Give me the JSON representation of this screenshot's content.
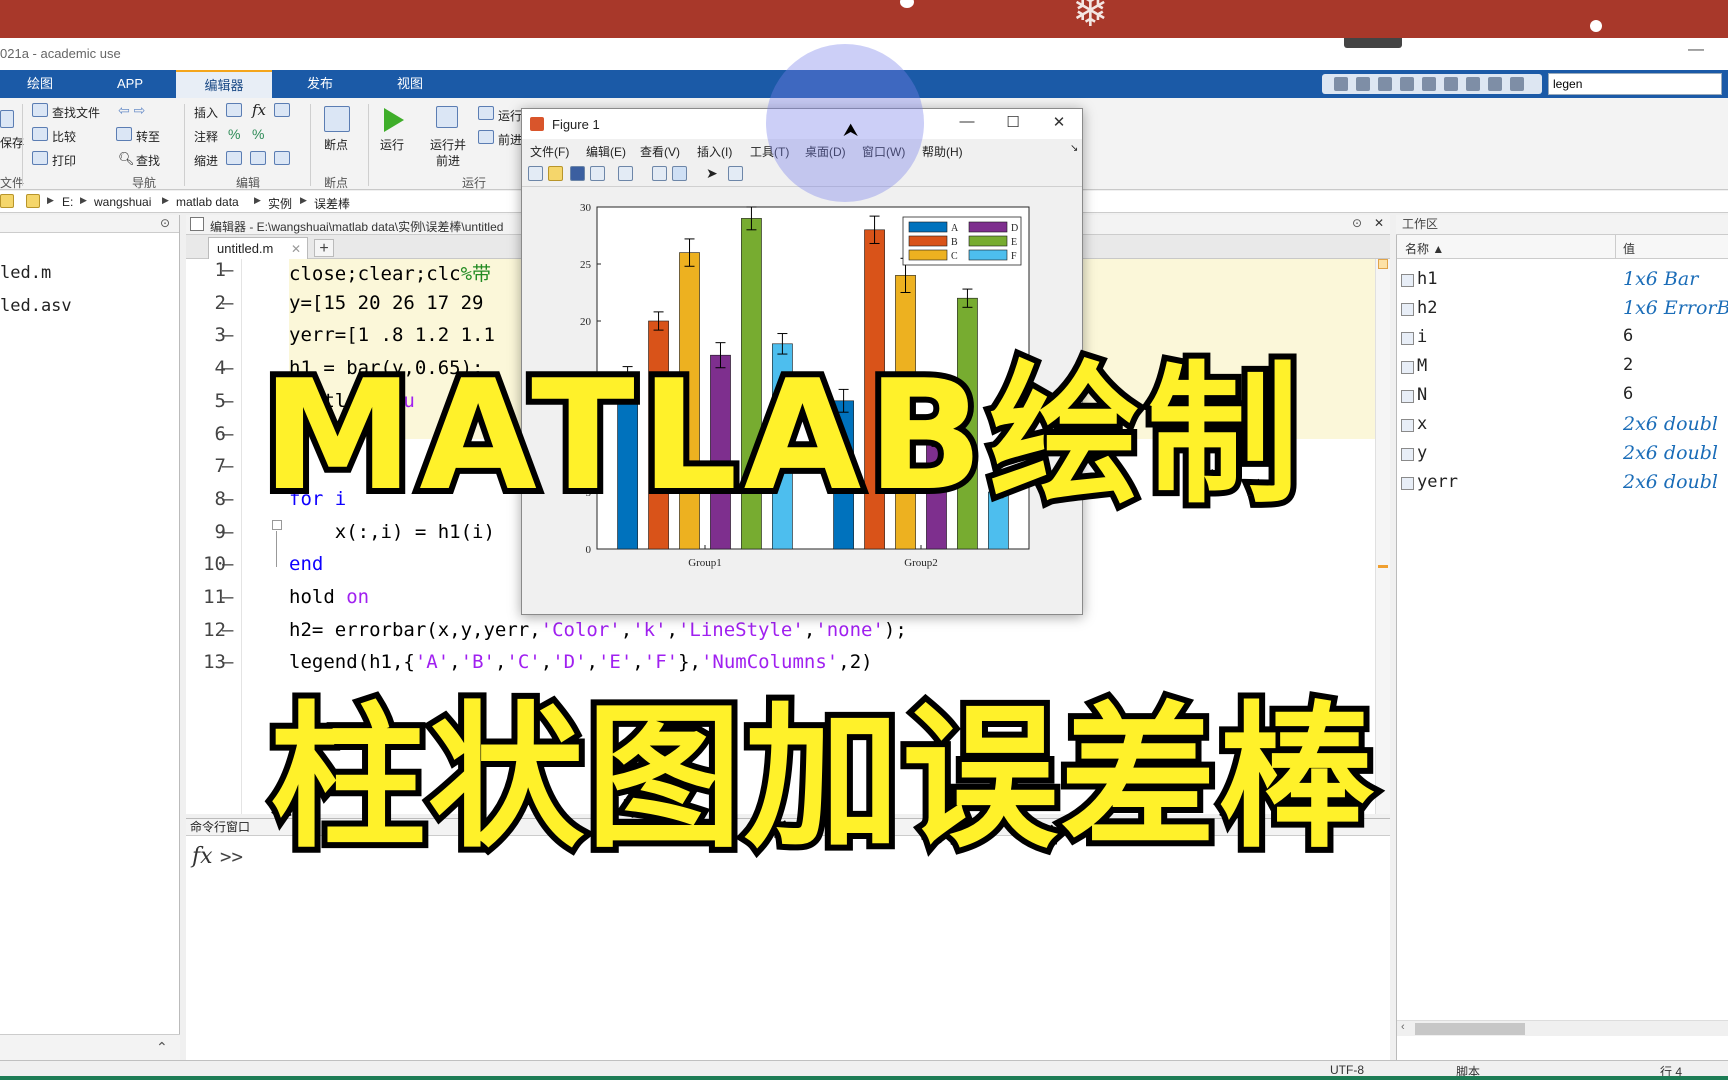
{
  "app": {
    "title": "021a - academic use",
    "minimize": "—"
  },
  "ribbon": {
    "tabs": [
      "绘图",
      "APP",
      "编辑器",
      "发布",
      "视图"
    ],
    "active_tab": "编辑器",
    "search_value": "legen",
    "file_group": {
      "save_label": "保存",
      "section": "文件"
    },
    "nav_group": {
      "find_files": "查找文件",
      "compare": "比较",
      "print": "打印",
      "goto": "转至",
      "find": "查找",
      "section": "导航"
    },
    "edit_group": {
      "insert": "插入",
      "comment": "注释",
      "indent": "缩进",
      "fx": "fx",
      "pct1": "%",
      "pct2": "%",
      "section": "编辑"
    },
    "breakpoint_group": {
      "label": "断点",
      "section": "断点"
    },
    "run_group": {
      "run": "运行",
      "run_advance_1": "运行并",
      "run_advance_2": "前进",
      "run_section": "运行节",
      "advance": "前进",
      "section": "运行"
    }
  },
  "address": {
    "crumbs": [
      "E:",
      "wangshuai",
      "matlab data",
      "实例",
      "误差棒"
    ]
  },
  "file_panel": {
    "files": [
      "led.m",
      "led.asv"
    ]
  },
  "editor": {
    "header": "编辑器 - E:\\wangshuai\\matlab data\\实例\\误差棒\\untitled",
    "tab": "untitled.m",
    "tab_close": "✕",
    "tab_add": "+",
    "lines": [
      {
        "n": "1",
        "code": [
          {
            "t": "close;clear;clc",
            "c": ""
          },
          {
            "t": "%带",
            "c": "cmt"
          }
        ]
      },
      {
        "n": "2",
        "code": [
          {
            "t": "y=[15 20 26 17 29",
            "c": ""
          }
        ]
      },
      {
        "n": "3",
        "code": [
          {
            "t": "yerr=[1 .8 1.2 1.1",
            "c": ""
          }
        ]
      },
      {
        "n": "4",
        "code": [
          {
            "t": "h1 = bar(y,0.65);",
            "c": ""
          }
        ]
      },
      {
        "n": "5",
        "code": [
          {
            "t": "   tls({",
            "c": ""
          },
          {
            "t": "'Gu",
            "c": "str"
          }
        ]
      },
      {
        "n": "6",
        "code": []
      },
      {
        "n": "7",
        "code": []
      },
      {
        "n": "8",
        "code": [
          {
            "t": "for i",
            "c": "kw"
          }
        ]
      },
      {
        "n": "9",
        "code": [
          {
            "t": "    x(:,i) = h1(i)",
            "c": ""
          }
        ]
      },
      {
        "n": "10",
        "code": [
          {
            "t": "end",
            "c": "kw"
          }
        ]
      },
      {
        "n": "11",
        "code": [
          {
            "t": "hold ",
            "c": ""
          },
          {
            "t": "on",
            "c": "str"
          }
        ]
      },
      {
        "n": "12",
        "code": [
          {
            "t": "h2= errorbar(x,y,yerr,",
            "c": ""
          },
          {
            "t": "'Color'",
            "c": "str"
          },
          {
            "t": ",",
            "c": ""
          },
          {
            "t": "'k'",
            "c": "str"
          },
          {
            "t": ",",
            "c": ""
          },
          {
            "t": "'LineStyle'",
            "c": "str"
          },
          {
            "t": ",",
            "c": ""
          },
          {
            "t": "'none'",
            "c": "str"
          },
          {
            "t": ");",
            "c": ""
          }
        ]
      },
      {
        "n": "13",
        "code": [
          {
            "t": "legend(h1,{",
            "c": ""
          },
          {
            "t": "'A'",
            "c": "str"
          },
          {
            "t": ",",
            "c": ""
          },
          {
            "t": "'B'",
            "c": "str"
          },
          {
            "t": ",",
            "c": ""
          },
          {
            "t": "'C'",
            "c": "str"
          },
          {
            "t": ",",
            "c": ""
          },
          {
            "t": "'D'",
            "c": "str"
          },
          {
            "t": ",",
            "c": ""
          },
          {
            "t": "'E'",
            "c": "str"
          },
          {
            "t": ",",
            "c": ""
          },
          {
            "t": "'F'",
            "c": "str"
          },
          {
            "t": "},",
            "c": ""
          },
          {
            "t": "'NumColumns'",
            "c": "str"
          },
          {
            "t": ",2)",
            "c": ""
          }
        ]
      }
    ]
  },
  "command_window": {
    "title": "命令行窗口",
    "fx": "fx",
    "prompt": ">>"
  },
  "workspace": {
    "title": "工作区",
    "col_name": "名称 ▲",
    "col_value": "值",
    "vars": [
      {
        "name": "h1",
        "value": "1x6 Bar",
        "num": false
      },
      {
        "name": "h2",
        "value": "1x6 ErrorB",
        "num": false
      },
      {
        "name": "i",
        "value": "6",
        "num": true
      },
      {
        "name": "M",
        "value": "2",
        "num": true
      },
      {
        "name": "N",
        "value": "6",
        "num": true
      },
      {
        "name": "x",
        "value": "2x6 doubl",
        "num": false
      },
      {
        "name": "y",
        "value": "2x6 doubl",
        "num": false
      },
      {
        "name": "yerr",
        "value": "2x6 doubl",
        "num": false
      }
    ]
  },
  "statusbar": {
    "encoding": "UTF-8",
    "type": "脚本",
    "position": "行  4"
  },
  "figure": {
    "title": "Figure 1",
    "controls": [
      "—",
      "☐",
      "✕"
    ],
    "menu": [
      "文件(F)",
      "编辑(E)",
      "查看(V)",
      "插入(I)",
      "工具(T)",
      "桌面(D)",
      "窗口(W)",
      "帮助(H)"
    ]
  },
  "chart_data": {
    "type": "bar",
    "categories": [
      "Group1",
      "Group2"
    ],
    "series": [
      {
        "name": "A",
        "values": [
          15,
          13
        ],
        "errors": [
          1,
          1
        ],
        "color": "#0072bd"
      },
      {
        "name": "B",
        "values": [
          20,
          28
        ],
        "errors": [
          0.8,
          1.2
        ],
        "color": "#d95319"
      },
      {
        "name": "C",
        "values": [
          26,
          24
        ],
        "errors": [
          1.2,
          1.5
        ],
        "color": "#edb120"
      },
      {
        "name": "D",
        "values": [
          17,
          10
        ],
        "errors": [
          1.1,
          1
        ],
        "color": "#7e2f8e"
      },
      {
        "name": "E",
        "values": [
          29,
          22
        ],
        "errors": [
          1,
          0.8
        ],
        "color": "#77ac30"
      },
      {
        "name": "F",
        "values": [
          18,
          5
        ],
        "errors": [
          0.9,
          0.5
        ],
        "color": "#4dbeee"
      }
    ],
    "ylim": [
      0,
      30
    ],
    "yticks": [
      0,
      5,
      10,
      15,
      20,
      25,
      30
    ],
    "legend_location": "top-right",
    "legend_columns": 2
  },
  "overlay": {
    "line1": "MATLAB绘制",
    "line2": "柱状图加误差棒"
  }
}
